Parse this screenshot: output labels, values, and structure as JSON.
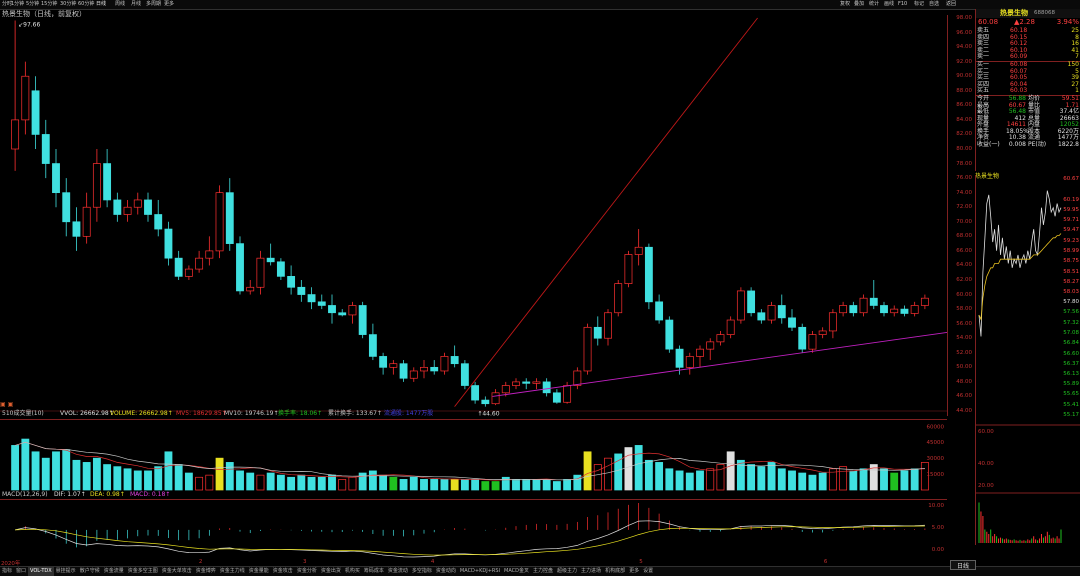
{
  "topbar": {
    "tabs": [
      "分时",
      "1分钟",
      "5分钟",
      "15分钟",
      "30分钟",
      "60分钟",
      "日线",
      "周线",
      "月线",
      "多周期",
      "更多"
    ],
    "active_tab": "日线",
    "right_buttons": [
      "复权",
      "叠加",
      "统计",
      "画线",
      "F10",
      "标记",
      "自选",
      "返回"
    ]
  },
  "chart": {
    "title": "热景生物（日线，前复权）",
    "high_label": "97.66",
    "low_label": "44.60",
    "price_ticks": [
      "98.00",
      "96.00",
      "94.00",
      "92.00",
      "90.00",
      "88.00",
      "86.00",
      "84.00",
      "82.00",
      "80.00",
      "78.00",
      "76.00",
      "74.00",
      "72.00",
      "70.00",
      "68.00",
      "66.00",
      "64.00",
      "62.00",
      "60.00",
      "58.00",
      "56.00",
      "54.00",
      "52.00",
      "50.00",
      "48.00",
      "46.00",
      "44.00"
    ],
    "chart_data": {
      "type": "candlestick",
      "title": "热景生物（日线，前复权）",
      "ylim": [
        44,
        98
      ],
      "ohlc": [
        [
          80,
          97.66,
          77,
          84
        ],
        [
          84,
          92,
          82,
          90
        ],
        [
          88,
          90,
          80,
          82
        ],
        [
          82,
          84,
          76,
          78
        ],
        [
          78,
          80,
          72,
          74
        ],
        [
          74,
          76,
          68,
          70
        ],
        [
          70,
          72,
          66,
          68
        ],
        [
          68,
          74,
          67,
          72
        ],
        [
          72,
          80,
          70,
          78
        ],
        [
          78,
          80,
          72,
          73
        ],
        [
          73,
          74,
          70,
          71
        ],
        [
          71,
          73,
          70,
          72
        ],
        [
          72,
          74,
          71,
          73
        ],
        [
          73,
          74,
          70,
          71
        ],
        [
          71,
          73,
          68,
          69
        ],
        [
          69,
          70,
          64,
          65
        ],
        [
          65,
          66,
          62,
          62.5
        ],
        [
          62.5,
          64,
          62,
          63.5
        ],
        [
          63.5,
          66,
          63,
          65
        ],
        [
          65,
          68,
          64,
          66
        ],
        [
          66,
          75,
          65,
          74
        ],
        [
          74,
          76,
          66,
          67
        ],
        [
          67,
          68,
          60,
          60.5
        ],
        [
          60.5,
          62,
          60,
          61
        ],
        [
          61,
          66,
          60,
          65
        ],
        [
          65,
          67,
          64,
          64.5
        ],
        [
          64.5,
          65,
          62,
          62.5
        ],
        [
          62.5,
          64,
          60,
          61
        ],
        [
          61,
          62,
          59,
          60
        ],
        [
          60,
          61,
          58,
          59
        ],
        [
          59,
          60,
          58,
          58.5
        ],
        [
          58.5,
          60,
          56,
          57.5
        ],
        [
          57.5,
          58,
          57,
          57.2
        ],
        [
          57.2,
          59,
          56,
          58.5
        ],
        [
          58.5,
          59,
          54,
          54.5
        ],
        [
          54.5,
          56,
          51,
          51.5
        ],
        [
          51.5,
          52,
          49,
          50
        ],
        [
          50,
          51,
          49,
          50.5
        ],
        [
          50.5,
          51,
          48,
          48.5
        ],
        [
          48.5,
          50,
          48,
          49.5
        ],
        [
          49.5,
          51,
          48.5,
          50
        ],
        [
          50,
          51,
          49,
          49.5
        ],
        [
          49.5,
          52,
          49,
          51.5
        ],
        [
          51.5,
          53,
          50,
          50.5
        ],
        [
          50.5,
          51,
          47,
          47.5
        ],
        [
          47.5,
          48,
          45,
          45.5
        ],
        [
          45.5,
          46,
          44.6,
          45
        ],
        [
          45,
          47,
          44.8,
          46.5
        ],
        [
          46.5,
          48,
          46,
          47.5
        ],
        [
          47.5,
          48.5,
          47,
          48
        ],
        [
          48,
          48.5,
          47,
          47.8
        ],
        [
          47.8,
          48.5,
          47,
          48
        ],
        [
          48,
          48.5,
          46,
          46.5
        ],
        [
          46.5,
          47,
          45,
          45.2
        ],
        [
          45.2,
          48,
          45,
          47.5
        ],
        [
          47.5,
          50,
          47,
          49.5
        ],
        [
          49.5,
          56,
          49,
          55.5
        ],
        [
          55.5,
          57,
          53,
          54
        ],
        [
          54,
          58,
          53,
          57.5
        ],
        [
          57.5,
          62,
          57,
          61.5
        ],
        [
          61.5,
          66,
          61,
          65.5
        ],
        [
          65.5,
          69,
          64,
          66.5
        ],
        [
          66.5,
          67,
          58,
          59
        ],
        [
          59,
          60,
          56,
          56.5
        ],
        [
          56.5,
          57,
          52,
          52.5
        ],
        [
          52.5,
          53,
          49,
          50
        ],
        [
          50,
          52,
          49,
          51.5
        ],
        [
          51.5,
          53,
          50,
          52.5
        ],
        [
          52.5,
          54,
          51,
          53.5
        ],
        [
          53.5,
          55,
          53,
          54.5
        ],
        [
          54.5,
          57,
          54,
          56.5
        ],
        [
          56.5,
          61,
          56,
          60.5
        ],
        [
          60.5,
          61,
          57,
          57.5
        ],
        [
          57.5,
          58,
          56,
          56.5
        ],
        [
          56.5,
          59,
          56,
          58.5
        ],
        [
          58.5,
          60,
          56,
          56.8
        ],
        [
          56.8,
          58,
          55,
          55.5
        ],
        [
          55.5,
          56,
          52,
          52.5
        ],
        [
          52.5,
          55,
          52,
          54.5
        ],
        [
          54.5,
          55.5,
          54,
          55
        ],
        [
          55,
          58,
          54,
          57.5
        ],
        [
          57.5,
          59,
          57,
          58.5
        ],
        [
          58.5,
          59,
          57,
          57.5
        ],
        [
          57.5,
          60,
          57,
          59.5
        ],
        [
          59.5,
          62,
          58,
          58.5
        ],
        [
          58.5,
          59,
          57,
          57.5
        ],
        [
          57.5,
          58.5,
          57,
          58
        ],
        [
          58,
          58.5,
          57,
          57.4
        ],
        [
          57.4,
          59,
          57,
          58.5
        ],
        [
          58.5,
          60,
          58,
          59.5
        ]
      ],
      "trendlines": [
        {
          "color": "#c01818",
          "from": [
            44.6,
            0.48
          ],
          "to": [
            98,
            0.8
          ]
        },
        {
          "color": "#c020c0",
          "from": [
            46,
            0.52
          ],
          "to": [
            54.8,
            1.0
          ]
        }
      ]
    }
  },
  "volume": {
    "header_items": [
      {
        "text": "510成交量(10)",
        "color": "#c8c8c8"
      },
      {
        "text": "VVOL: 26662.98↑",
        "color": "#e0e0e0"
      },
      {
        "text": "VOLUME: 26662.98↑",
        "color": "#e8e020"
      },
      {
        "text": "MV5: 18629.85↑",
        "color": "#e03030"
      },
      {
        "text": "MV10: 19746.19↑",
        "color": "#c8c8c8"
      },
      {
        "text": "换手率: 18.06↑",
        "color": "#20c020"
      },
      {
        "text": "累计换手: 133.67↑",
        "color": "#c8c8c8"
      },
      {
        "text": "流通股: 1477万股",
        "color": "#4040e0"
      }
    ],
    "ticks": [
      "60000",
      "45000",
      "30000",
      "15000"
    ],
    "chart_data": {
      "type": "bar",
      "ylim": [
        0,
        65000
      ],
      "values": [
        42000,
        48000,
        36000,
        30000,
        36000,
        38000,
        28000,
        26000,
        30000,
        24000,
        22000,
        20000,
        18000,
        18000,
        22000,
        36000,
        24000,
        16000,
        12000,
        14000,
        30000,
        26000,
        18000,
        16000,
        14000,
        16000,
        14000,
        12000,
        14000,
        12000,
        12000,
        14000,
        10000,
        12000,
        16000,
        18000,
        14000,
        12000,
        10000,
        12000,
        10000,
        10000,
        10000,
        10000,
        10000,
        10000,
        8000,
        8000,
        12000,
        10000,
        10000,
        10000,
        10000,
        8000,
        10000,
        14000,
        36000,
        24000,
        30000,
        34000,
        40000,
        42000,
        28000,
        26000,
        20000,
        18000,
        16000,
        18000,
        20000,
        24000,
        36000,
        28000,
        24000,
        22000,
        26000,
        20000,
        18000,
        16000,
        14000,
        16000,
        20000,
        22000,
        18000,
        20000,
        24000,
        20000,
        16000,
        18000,
        20000,
        26000
      ],
      "colors": [
        "cyan",
        "cyan",
        "cyan",
        "cyan",
        "cyan",
        "cyan",
        "cyan",
        "cyan",
        "cyan",
        "cyan",
        "cyan",
        "cyan",
        "cyan",
        "cyan",
        "cyan",
        "cyan",
        "cyan",
        "cyan",
        "red",
        "red",
        "yellow",
        "cyan",
        "cyan",
        "cyan",
        "red",
        "cyan",
        "cyan",
        "cyan",
        "cyan",
        "cyan",
        "cyan",
        "cyan",
        "red",
        "red",
        "cyan",
        "cyan",
        "cyan",
        "green",
        "cyan",
        "cyan",
        "cyan",
        "cyan",
        "cyan",
        "yellow",
        "cyan",
        "cyan",
        "green",
        "green",
        "cyan",
        "cyan",
        "cyan",
        "cyan",
        "cyan",
        "cyan",
        "cyan",
        "cyan",
        "yellow",
        "red",
        "red",
        "cyan",
        "white",
        "cyan",
        "cyan",
        "cyan",
        "cyan",
        "cyan",
        "cyan",
        "cyan",
        "red",
        "red",
        "white",
        "cyan",
        "cyan",
        "cyan",
        "cyan",
        "cyan",
        "cyan",
        "cyan",
        "cyan",
        "cyan",
        "red",
        "red",
        "cyan",
        "cyan",
        "white",
        "cyan",
        "green",
        "cyan",
        "cyan",
        "red"
      ]
    }
  },
  "macd": {
    "header_items": [
      {
        "text": "MACD(12,26,9)",
        "color": "#c8c8c8"
      },
      {
        "text": "DIF: 1.07↑",
        "color": "#e0e0e0"
      },
      {
        "text": "DEA: 0.98↑",
        "color": "#e8e020"
      },
      {
        "text": "MACD: 0.18↑",
        "color": "#e040e0"
      }
    ],
    "ticks": [
      "10.00",
      "5.00",
      "0.00"
    ]
  },
  "dates": {
    "labels": [
      {
        "text": "2020年",
        "pos": 0.001
      },
      {
        "text": "2",
        "pos": 0.21
      },
      {
        "text": "3",
        "pos": 0.32
      },
      {
        "text": "4",
        "pos": 0.455
      },
      {
        "text": "5",
        "pos": 0.675
      },
      {
        "text": "6",
        "pos": 0.87
      }
    ]
  },
  "bottombar": {
    "tabs": [
      "指标",
      "窗口",
      "VOL-TDX",
      "悬挂提示",
      "散户守候",
      "资金流量",
      "资金多空主图",
      "资金大单攻击",
      "资金博弈",
      "资金主力线",
      "资金量能",
      "资金攻击",
      "资金分析",
      "资金出货",
      "机构买",
      "筹码成本",
      "资金流动",
      "多空指标",
      "资金动向",
      "MACD+KDJ+RSI",
      "MACD金叉",
      "主力控盘",
      "超级主力",
      "主力进场",
      "机构底部",
      "更多",
      "设置"
    ],
    "active_tab": "VOL-TDX"
  },
  "quote": {
    "stock_name": "热景生物",
    "stock_code": "688068",
    "price": "60.08",
    "change": "▲2.28",
    "change_pct": "3.94%",
    "asks": [
      {
        "label": "卖五",
        "price": "60.18",
        "vol": "25"
      },
      {
        "label": "卖四",
        "price": "60.15",
        "vol": "8"
      },
      {
        "label": "卖三",
        "price": "60.12",
        "vol": "16"
      },
      {
        "label": "卖二",
        "price": "60.10",
        "vol": "41"
      },
      {
        "label": "卖一",
        "price": "60.09",
        "vol": "7"
      }
    ],
    "bids": [
      {
        "label": "买一",
        "price": "60.08",
        "vol": "150"
      },
      {
        "label": "买二",
        "price": "60.07",
        "vol": "5"
      },
      {
        "label": "买三",
        "price": "60.05",
        "vol": "39"
      },
      {
        "label": "买四",
        "price": "60.04",
        "vol": "27"
      },
      {
        "label": "买五",
        "price": "60.03",
        "vol": "1"
      }
    ],
    "stats": [
      {
        "k1": "今开",
        "v1": "56.88",
        "c1": "green",
        "k2": "均价",
        "v2": "59.51",
        "c2": "red"
      },
      {
        "k1": "最高",
        "v1": "60.67",
        "c1": "red",
        "k2": "量比",
        "v2": "1.71",
        "c2": "red"
      },
      {
        "k1": "最低",
        "v1": "56.48",
        "c1": "green",
        "k2": "市值",
        "v2": "37.4亿",
        "c2": "white"
      },
      {
        "k1": "现量",
        "v1": "412",
        "c1": "white",
        "k2": "总量",
        "v2": "26663",
        "c2": "white"
      },
      {
        "k1": "外盘",
        "v1": "14611",
        "c1": "red",
        "k2": "内盘",
        "v2": "12052",
        "c2": "green"
      },
      {
        "k1": "换手",
        "v1": "18.05%",
        "c1": "white",
        "k2": "股本",
        "v2": "6220万",
        "c2": "white"
      },
      {
        "k1": "净资",
        "v1": "10.38",
        "c1": "white",
        "k2": "流通",
        "v2": "1477万",
        "c2": "white"
      },
      {
        "k1": "收益(一)",
        "v1": "0.008",
        "c1": "white",
        "k2": "PE(动)",
        "v2": "1822.8",
        "c2": "white"
      }
    ]
  },
  "mini": {
    "title": "热景生物",
    "ticks": [
      "60.67",
      "60.19",
      "59.95",
      "59.71",
      "59.47",
      "59.23",
      "58.99",
      "58.75",
      "58.51",
      "58.27",
      "58.03",
      "57.80",
      "57.56",
      "57.32",
      "57.08",
      "56.84",
      "56.60",
      "56.37",
      "56.13",
      "55.89",
      "55.65",
      "55.41",
      "55.17"
    ],
    "left_ticks": [
      "60.00",
      "40.00",
      "20.00"
    ],
    "bottom_tab": "日线",
    "chart_data": {
      "type": "line",
      "ylim": [
        55.17,
        60.67
      ],
      "price": [
        57.5,
        57.0,
        58.5,
        59.3,
        60.1,
        60.3,
        59.8,
        59.2,
        59.5,
        59.0,
        59.6,
        58.9,
        59.3,
        58.8,
        59.1,
        58.7,
        59.0,
        58.6,
        58.8,
        58.7,
        58.9,
        58.6,
        58.8,
        58.9,
        58.7,
        59.0,
        58.8,
        59.2,
        59.5,
        59.0,
        58.9,
        59.4,
        60.0,
        59.6,
        59.9,
        60.4,
        60.2,
        59.9,
        60.0,
        59.8,
        60.1,
        59.9,
        60.0
      ],
      "avg": [
        57.5,
        57.4,
        57.9,
        58.2,
        58.4,
        58.5,
        58.6,
        58.6,
        58.7,
        58.7,
        58.7,
        58.8,
        58.8,
        58.8,
        58.8,
        58.8,
        58.8,
        58.8,
        58.8,
        58.8,
        58.8,
        58.8,
        58.8,
        58.8,
        58.8,
        58.8,
        58.8,
        58.85,
        58.9,
        58.9,
        58.9,
        58.95,
        59.0,
        59.05,
        59.1,
        59.15,
        59.2,
        59.25,
        59.3,
        59.3,
        59.35,
        59.35,
        59.4
      ],
      "volume": [
        0.9,
        0.7,
        0.6,
        0.3,
        0.25,
        0.2,
        0.3,
        0.15,
        0.2,
        0.15,
        0.1,
        0.12,
        0.1,
        0.08,
        0.1,
        0.08,
        0.07,
        0.06,
        0.08,
        0.06,
        0.05,
        0.07,
        0.05,
        0.06,
        0.05,
        0.08,
        0.06,
        0.1,
        0.15,
        0.08,
        0.06,
        0.1,
        0.2,
        0.12,
        0.15,
        0.25,
        0.18,
        0.1,
        0.12,
        0.1,
        0.15,
        0.1,
        0.3
      ]
    }
  }
}
